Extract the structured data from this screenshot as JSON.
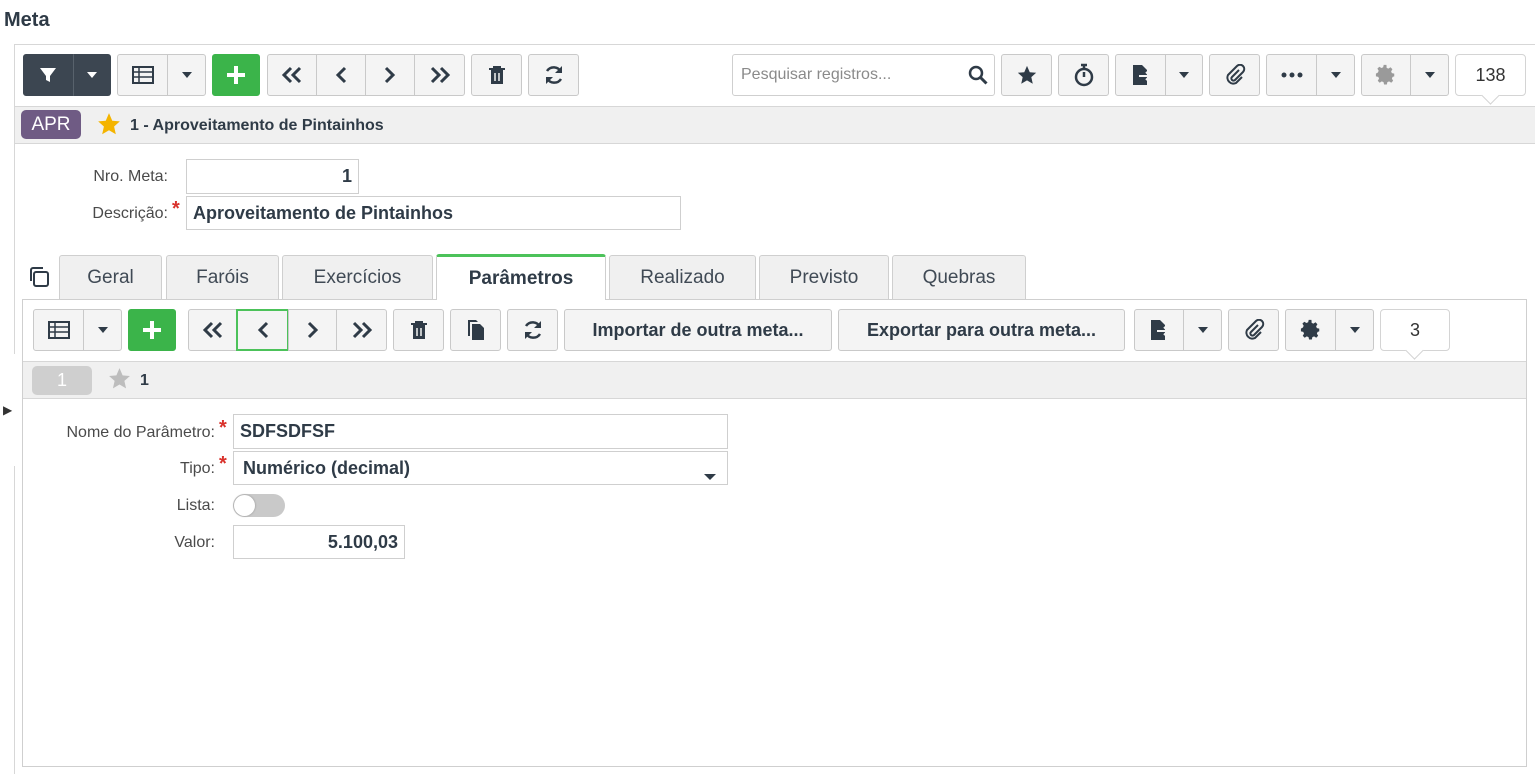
{
  "window": {
    "title": "Meta"
  },
  "toolbar": {
    "search_placeholder": "Pesquisar registros...",
    "record_count": "138"
  },
  "record": {
    "badge": "APR",
    "title": "1 - Aproveitamento de Pintainhos"
  },
  "form": {
    "nro_label": "Nro. Meta:",
    "nro_value": "1",
    "descricao_label": "Descrição:",
    "descricao_value": "Aproveitamento de Pintainhos"
  },
  "tabs": [
    {
      "label": "Geral"
    },
    {
      "label": "Faróis"
    },
    {
      "label": "Exercícios"
    },
    {
      "label": "Parâmetros"
    },
    {
      "label": "Realizado"
    },
    {
      "label": "Previsto"
    },
    {
      "label": "Quebras"
    }
  ],
  "active_tab": "Parâmetros",
  "subtoolbar": {
    "import_label": "Importar de outra meta...",
    "export_label": "Exportar para outra meta...",
    "record_count": "3"
  },
  "subrecord": {
    "pill": "1",
    "title": "1"
  },
  "param_form": {
    "nome_label": "Nome do Parâmetro:",
    "nome_value": "SDFSDFSF",
    "tipo_label": "Tipo:",
    "tipo_value": "Numérico (decimal)",
    "lista_label": "Lista:",
    "lista_on": false,
    "valor_label": "Valor:",
    "valor_value": "5.100,03"
  },
  "colors": {
    "accent_green": "#3bb44a",
    "dark_button": "#3c4651",
    "badge_purple": "#6f5b84",
    "required_red": "#d9312b",
    "star_gold": "#f4b400"
  }
}
